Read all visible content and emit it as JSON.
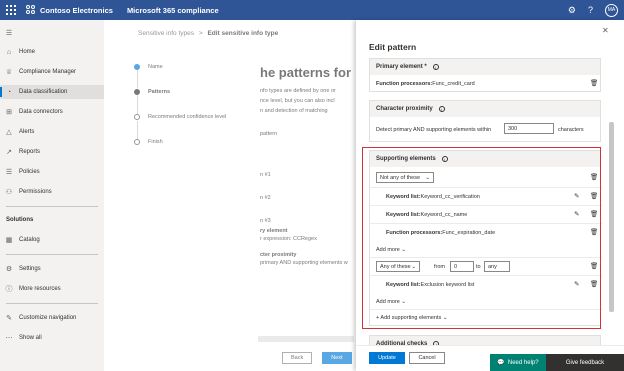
{
  "topbar": {
    "brand": "Contoso Electronics",
    "app": "Microsoft 365 compliance",
    "avatar": "MA",
    "icons": [
      "waffle-icon",
      "gear-icon",
      "help-icon"
    ]
  },
  "sidebar": {
    "items": [
      {
        "label": "Home",
        "icon": "home-icon"
      },
      {
        "label": "Compliance Manager",
        "icon": "trophy-icon"
      },
      {
        "label": "Data classification",
        "icon": "classification-icon",
        "active": true
      },
      {
        "label": "Data connectors",
        "icon": "connector-icon"
      },
      {
        "label": "Alerts",
        "icon": "alert-icon"
      },
      {
        "label": "Reports",
        "icon": "report-icon"
      },
      {
        "label": "Policies",
        "icon": "policy-icon"
      },
      {
        "label": "Permissions",
        "icon": "permission-icon"
      }
    ],
    "solutions_heading": "Solutions",
    "items2": [
      {
        "label": "Catalog",
        "icon": "catalog-icon"
      },
      {
        "label": "Settings",
        "icon": "gear-icon"
      },
      {
        "label": "More resources",
        "icon": "info-icon"
      },
      {
        "label": "Customize navigation",
        "icon": "edit-icon"
      },
      {
        "label": "Show all",
        "icon": "ellipsis-icon"
      }
    ]
  },
  "content": {
    "crumb_parent": "Sensitive info types",
    "crumb_sep": ">",
    "crumb_current": "Edit sensitive info type",
    "steps": [
      "Name",
      "Patterns",
      "Recommended confidence level",
      "Finish"
    ],
    "title": "he patterns for",
    "body": [
      "nfo types are defined by one or",
      "nce level, but you can also incl",
      "n and detection of matching",
      "pattern",
      "n #1",
      "n #2",
      "n #3",
      "ry element",
      "r expression: CCRegex",
      "cter proximity",
      " primary AND supporting elements w"
    ],
    "back": "Back",
    "next": "Next"
  },
  "panel": {
    "title": "Edit pattern",
    "primary_heading": "Primary element *",
    "primary_label": "Function processors:",
    "primary_value": "Func_credit_card",
    "proximity_heading": "Character proximity",
    "proximity_text": "Detect primary AND supporting elements within",
    "proximity_value": "300",
    "proximity_unit": "characters",
    "supporting_heading": "Supporting elements",
    "group1_select": "Not any of these",
    "group1_items": [
      {
        "label": "Keyword list:",
        "value": "Keyword_cc_verification",
        "editable": true
      },
      {
        "label": "Keyword list:",
        "value": "Keyword_cc_name",
        "editable": true
      },
      {
        "label": "Function processors:",
        "value": "Func_expiration_date",
        "editable": false
      }
    ],
    "add_more": "Add more",
    "group2_select": "Any of these",
    "from_label": "from",
    "from_value": "0",
    "to_label": "to",
    "to_value": "any",
    "group2_items": [
      {
        "label": "Keyword list:",
        "value": "Exclusion keyword list",
        "editable": true
      }
    ],
    "add_supporting": "+ Add supporting elements",
    "additional_checks": "Additional checks",
    "update": "Update",
    "cancel": "Cancel"
  },
  "help": {
    "need_help": "Need help?",
    "feedback": "Give feedback"
  },
  "colors": {
    "topbar": "#2f5597",
    "accent": "#0078d4",
    "highlight": "#d13438",
    "help": "#008272"
  }
}
